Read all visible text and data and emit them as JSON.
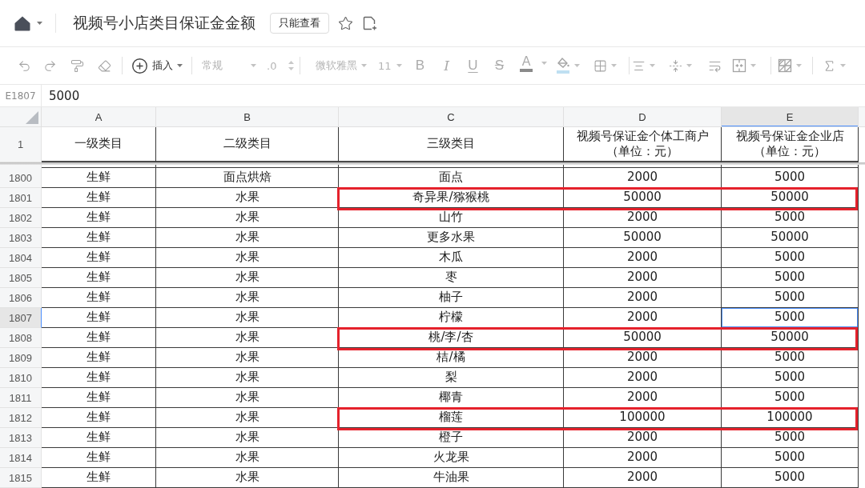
{
  "title_bar": {
    "title": "视频号小店类目保证金金额",
    "badge": "只能查看"
  },
  "toolbar": {
    "insert": "插入",
    "number_format": "常规",
    "decimal": ".0",
    "font_name": "微软雅黑",
    "font_size": "11",
    "text_styles": [
      {
        "kind": "bold",
        "label": "B"
      },
      {
        "kind": "italic",
        "label": "I"
      },
      {
        "kind": "underline",
        "label": "U"
      },
      {
        "kind": "strike",
        "label": "S"
      }
    ],
    "font_color": "A"
  },
  "formula_bar": {
    "cell_ref": "E1807",
    "value": "5000"
  },
  "sheet": {
    "columns": [
      {
        "letter": "A",
        "selected": false
      },
      {
        "letter": "B",
        "selected": false
      },
      {
        "letter": "C",
        "selected": false
      },
      {
        "letter": "D",
        "selected": false
      },
      {
        "letter": "E",
        "selected": true
      }
    ],
    "header_row": {
      "number": "1",
      "cells": [
        "一级类目",
        "二级类目",
        "三级类目",
        "视频号保证金个体工商户（单位：元）",
        "视频号保证金企业店（单位：元）"
      ]
    },
    "rows": [
      {
        "number": "1800",
        "selected": false,
        "highlighted": false,
        "cells": [
          "生鲜",
          "面点烘焙",
          "面点",
          "2000",
          "5000"
        ]
      },
      {
        "number": "1801",
        "selected": false,
        "highlighted": true,
        "cells": [
          "生鲜",
          "水果",
          "奇异果/猕猴桃",
          "50000",
          "50000"
        ]
      },
      {
        "number": "1802",
        "selected": false,
        "highlighted": false,
        "cells": [
          "生鲜",
          "水果",
          "山竹",
          "2000",
          "5000"
        ]
      },
      {
        "number": "1803",
        "selected": false,
        "highlighted": false,
        "cells": [
          "生鲜",
          "水果",
          "更多水果",
          "50000",
          "50000"
        ]
      },
      {
        "number": "1804",
        "selected": false,
        "highlighted": false,
        "cells": [
          "生鲜",
          "水果",
          "木瓜",
          "2000",
          "5000"
        ]
      },
      {
        "number": "1805",
        "selected": false,
        "highlighted": false,
        "cells": [
          "生鲜",
          "水果",
          "枣",
          "2000",
          "5000"
        ]
      },
      {
        "number": "1806",
        "selected": false,
        "highlighted": false,
        "cells": [
          "生鲜",
          "水果",
          "柚子",
          "2000",
          "5000"
        ]
      },
      {
        "number": "1807",
        "selected": true,
        "highlighted": false,
        "cells": [
          "生鲜",
          "水果",
          "柠檬",
          "2000",
          "5000"
        ]
      },
      {
        "number": "1808",
        "selected": false,
        "highlighted": true,
        "cells": [
          "生鲜",
          "水果",
          "桃/李/杏",
          "50000",
          "50000"
        ]
      },
      {
        "number": "1809",
        "selected": false,
        "highlighted": false,
        "cells": [
          "生鲜",
          "水果",
          "桔/橘",
          "2000",
          "5000"
        ]
      },
      {
        "number": "1810",
        "selected": false,
        "highlighted": false,
        "cells": [
          "生鲜",
          "水果",
          "梨",
          "2000",
          "5000"
        ]
      },
      {
        "number": "1811",
        "selected": false,
        "highlighted": false,
        "cells": [
          "生鲜",
          "水果",
          "椰青",
          "2000",
          "5000"
        ]
      },
      {
        "number": "1812",
        "selected": false,
        "highlighted": true,
        "cells": [
          "生鲜",
          "水果",
          "榴莲",
          "100000",
          "100000"
        ]
      },
      {
        "number": "1813",
        "selected": false,
        "highlighted": false,
        "cells": [
          "生鲜",
          "水果",
          "橙子",
          "2000",
          "5000"
        ]
      },
      {
        "number": "1814",
        "selected": false,
        "highlighted": false,
        "cells": [
          "生鲜",
          "水果",
          "火龙果",
          "2000",
          "5000"
        ]
      },
      {
        "number": "1815",
        "selected": false,
        "highlighted": false,
        "cells": [
          "生鲜",
          "水果",
          "牛油果",
          "2000",
          "5000"
        ]
      }
    ]
  }
}
